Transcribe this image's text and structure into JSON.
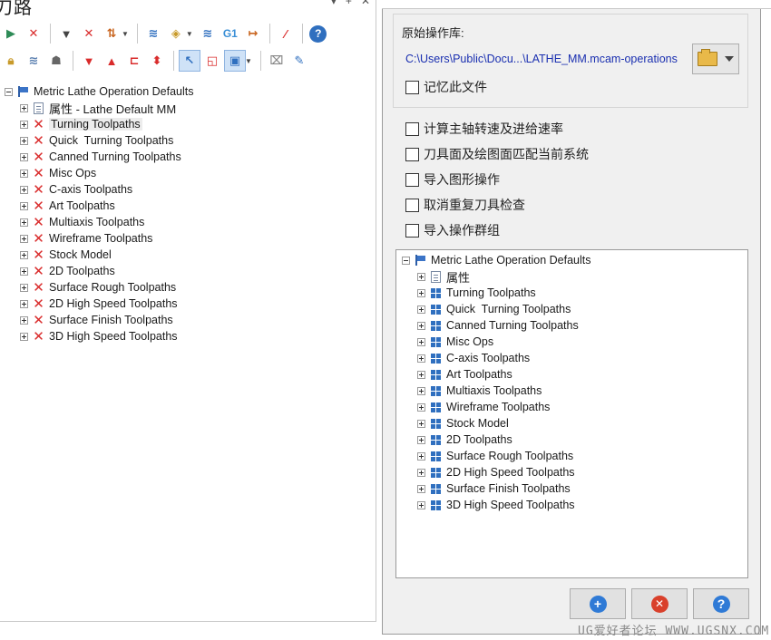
{
  "panel_title": "刀路",
  "title_buttons": [
    "▾",
    "+",
    "✕"
  ],
  "toolbar_row1": [
    {
      "icon": "select-arrow-green-icon",
      "color": "#2e8b57"
    },
    {
      "icon": "deselect-arrow-icon",
      "color": "#d92b2b"
    },
    {
      "icon": "regenerate-icon",
      "color": "#444"
    },
    {
      "icon": "regenerate-dirty-icon",
      "color": "#d92b2b"
    },
    {
      "icon": "toggle-display-icon",
      "color": "#c8641e"
    },
    {
      "icon": "backplot-icon",
      "color": "#2f6fbf"
    },
    {
      "icon": "verify-icon",
      "color": "#c89a2a"
    },
    {
      "icon": "simulate-icon",
      "color": "#2f6fbf"
    },
    {
      "icon": "post-g1-icon",
      "color": "#3a8fd6",
      "label": "G1"
    },
    {
      "icon": "post-arrow-icon",
      "color": "#c8641e"
    },
    {
      "icon": "magic-wand-icon",
      "color": "#d92b2b"
    },
    {
      "icon": "help-icon",
      "color": "#2f6fbf",
      "label": "?"
    }
  ],
  "toolbar_row2": [
    {
      "icon": "lock-icon",
      "color": "#c89a2a"
    },
    {
      "icon": "wave-icon",
      "color": "#5a7fb0"
    },
    {
      "icon": "ghost-icon",
      "color": "#666"
    },
    {
      "icon": "move-down-icon",
      "color": "#d92b2b"
    },
    {
      "icon": "move-up-icon",
      "color": "#d92b2b"
    },
    {
      "icon": "insert-arrow-icon",
      "color": "#d92b2b"
    },
    {
      "icon": "expand-collapse-icon",
      "color": "#d92b2b"
    },
    {
      "icon": "display-selected-icon",
      "color": "#2f6fbf"
    },
    {
      "icon": "display-window-icon",
      "color": "#d92b2b"
    },
    {
      "icon": "options-icon",
      "color": "#2f6fbf"
    },
    {
      "icon": "cleanup-icon",
      "color": "#888"
    },
    {
      "icon": "edit-icon",
      "color": "#2f6fbf"
    }
  ],
  "left_tree": {
    "root": "Metric Lathe Operation Defaults",
    "properties": "属性 - Lathe Default MM",
    "groups": [
      "Turning Toolpaths",
      "Quick  Turning Toolpaths",
      "Canned Turning Toolpaths",
      "Misc Ops",
      "C-axis Toolpaths",
      "Art Toolpaths",
      "Multiaxis Toolpaths",
      "Wireframe Toolpaths",
      "Stock Model",
      "2D Toolpaths",
      "Surface Rough Toolpaths",
      "2D High Speed Toolpaths",
      "Surface Finish Toolpaths",
      "3D High Speed Toolpaths"
    ]
  },
  "source": {
    "label": "原始操作库:",
    "path": "C:\\Users\\Public\\Docu...\\LATHE_MM.mcam-operations",
    "remember": "记忆此文件"
  },
  "options": [
    "计算主轴转速及进给速率",
    "刀具面及绘图面匹配当前系统",
    "导入图形操作",
    "取消重复刀具检查",
    "导入操作群组"
  ],
  "right_tree": {
    "root": "Metric Lathe Operation Defaults",
    "properties": "属性",
    "groups": [
      "Turning Toolpaths",
      "Quick  Turning Toolpaths",
      "Canned Turning Toolpaths",
      "Misc Ops",
      "C-axis Toolpaths",
      "Art Toolpaths",
      "Multiaxis Toolpaths",
      "Wireframe Toolpaths",
      "Stock Model",
      "2D Toolpaths",
      "Surface Rough Toolpaths",
      "2D High Speed Toolpaths",
      "Surface Finish Toolpaths",
      "3D High Speed Toolpaths"
    ]
  },
  "buttons": {
    "ok": {
      "glyph": "+",
      "color": "#2f7ad6"
    },
    "cancel": {
      "glyph": "✕",
      "color": "#d9402b"
    },
    "help": {
      "glyph": "?",
      "color": "#2f7ad6"
    }
  },
  "watermark": "UG爱好者论坛 WWW.UGSNX.COM"
}
